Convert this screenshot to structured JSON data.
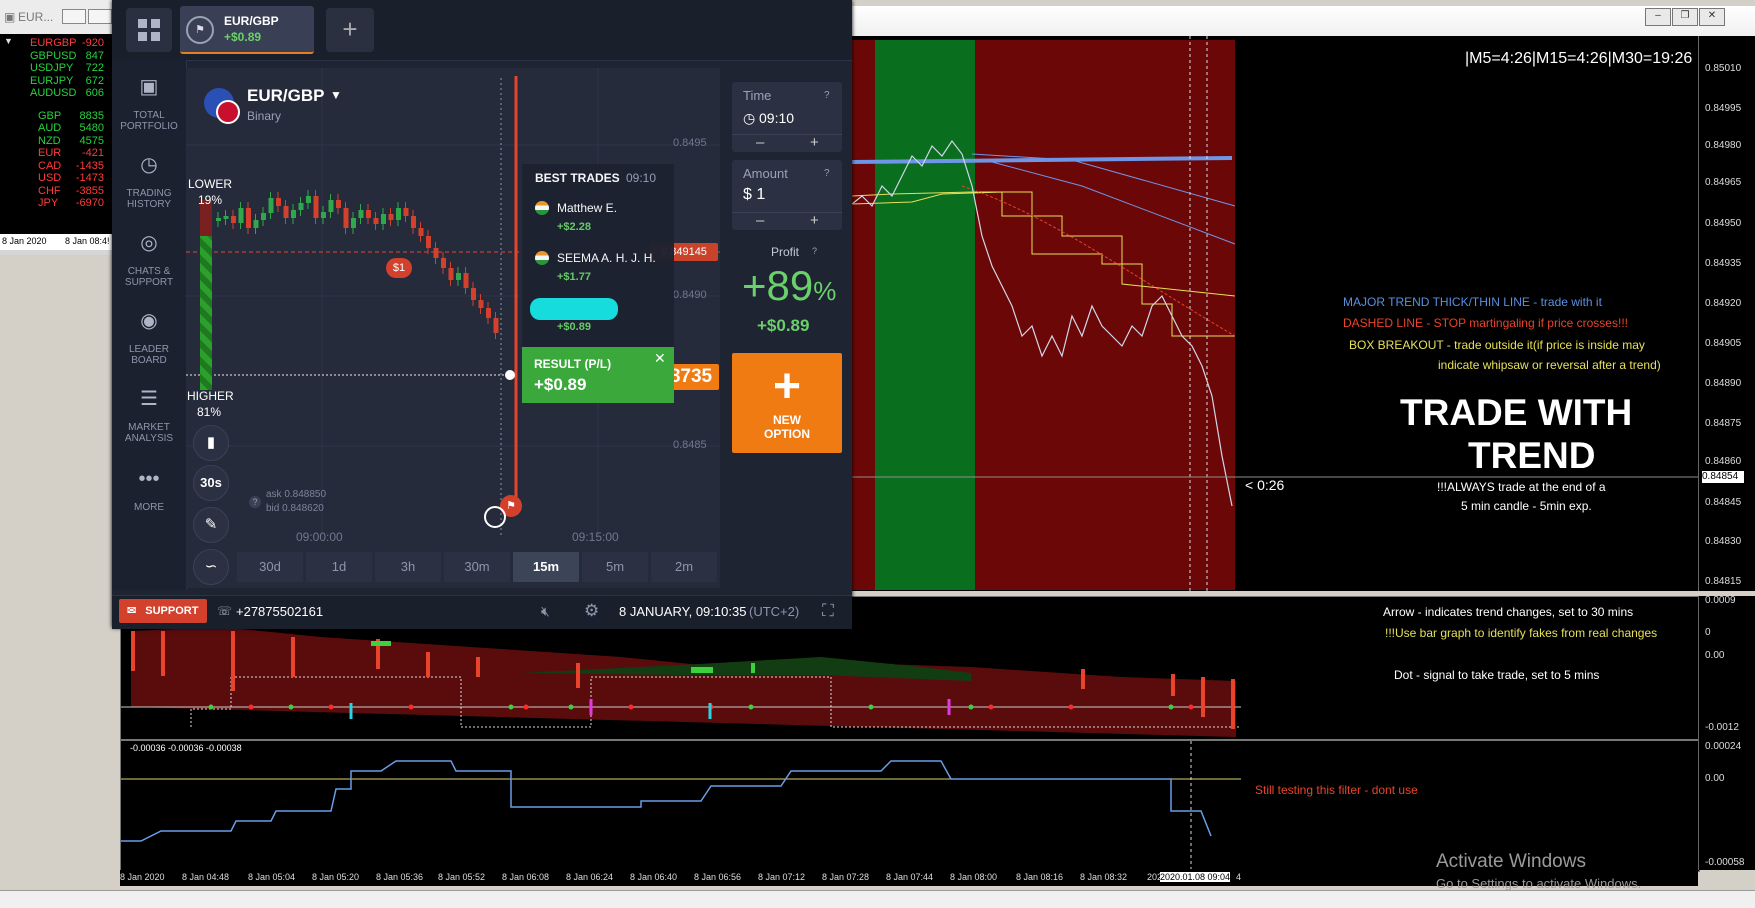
{
  "mt4": {
    "left_title": "EUR...",
    "currency_list": [
      {
        "name": "EURGBP",
        "value": "-920",
        "color": "#ff3b3b"
      },
      {
        "name": "GBPUSD",
        "value": "847",
        "color": "#27d13f"
      },
      {
        "name": "USDJPY",
        "value": "722",
        "color": "#27d13f"
      },
      {
        "name": "EURJPY",
        "value": "672",
        "color": "#27d13f"
      },
      {
        "name": "AUDUSD",
        "value": "606",
        "color": "#27d13f"
      },
      {
        "name": "GBP",
        "value": "8835",
        "color": "#27d13f"
      },
      {
        "name": "AUD",
        "value": "5480",
        "color": "#27d13f"
      },
      {
        "name": "NZD",
        "value": "4575",
        "color": "#27d13f"
      },
      {
        "name": "EUR",
        "value": "-421",
        "color": "#ff3b3b"
      },
      {
        "name": "CAD",
        "value": "-1435",
        "color": "#ff3b3b"
      },
      {
        "name": "USD",
        "value": "-1473",
        "color": "#ff3b3b"
      },
      {
        "name": "CHF",
        "value": "-3855",
        "color": "#ff3b3b"
      },
      {
        "name": "JPY",
        "value": "-6970",
        "color": "#ff3b3b"
      }
    ],
    "left_dates": [
      "8 Jan 2020",
      "8 Jan 08:4!"
    ],
    "timer_text": "|M5=4:26|M15=4:26|M30=19:26",
    "candle_timer": "< 0:26",
    "price_axis": [
      "0.85010",
      "0.84995",
      "0.84980",
      "0.84965",
      "0.84950",
      "0.84935",
      "0.84920",
      "0.84905",
      "0.84890",
      "0.84875",
      "0.84860",
      "0.84854",
      "0.84845",
      "0.84830",
      "0.84815"
    ],
    "sub1_axis": [
      "0.0009",
      "0",
      "0.00",
      "-0.0012"
    ],
    "sub2_axis": [
      "0.00024",
      "0.00",
      "-0.00058"
    ],
    "sub2_header": "-0.00036 -0.00036 -0.00038",
    "annotations": {
      "major_trend": "MAJOR TREND THICK/THIN LINE  - trade with it",
      "dashed_line": "DASHED LINE - STOP martingaling if price crosses!!!",
      "box_breakout": "BOX BREAKOUT - trade outside it(if price is inside may",
      "box_breakout2": "indicate whipsaw or reversal after a trend)",
      "trade_with": "TRADE WITH",
      "trend": "TREND",
      "always1": "!!!ALWAYS trade at the end of a",
      "always2": "5 min candle - 5min exp.",
      "arrow": "Arrow - indicates trend changes, set to 30 mins",
      "use_bar": "!!!Use bar graph to identify fakes from real changes",
      "dot": "Dot - signal to take trade, set to 5 mins",
      "still_testing": "Still testing this filter - dont use"
    },
    "timeline": [
      "8 Jan 2020",
      "8 Jan 04:48",
      "8 Jan 05:04",
      "8 Jan 05:20",
      "8 Jan 05:36",
      "8 Jan 05:52",
      "8 Jan 06:08",
      "8 Jan 06:24",
      "8 Jan 06:40",
      "8 Jan 06:56",
      "8 Jan 07:12",
      "8 Jan 07:28",
      "8 Jan 07:44",
      "8 Jan 08:00",
      "8 Jan 08:16",
      "8 Jan 08:32",
      "202",
      "2020.01.08 09:04",
      "4"
    ],
    "watermark1": "Activate Windows",
    "watermark2": "Go to Settings to activate Windows."
  },
  "iq": {
    "tab": {
      "pair": "EUR/GBP",
      "profit": "+$0.89"
    },
    "asset": {
      "name": "EUR/GBP",
      "type": "Binary"
    },
    "sidebar": [
      {
        "label1": "TOTAL",
        "label2": "PORTFOLIO",
        "icon": "briefcase-icon"
      },
      {
        "label1": "TRADING",
        "label2": "HISTORY",
        "icon": "history-icon"
      },
      {
        "label1": "CHATS &",
        "label2": "SUPPORT",
        "icon": "chat-icon"
      },
      {
        "label1": "LEADER",
        "label2": "BOARD",
        "icon": "leaderboard-icon"
      },
      {
        "label1": "MARKET",
        "label2": "ANALYSIS",
        "icon": "analysis-icon"
      },
      {
        "label1": "MORE",
        "label2": "",
        "icon": "more-icon"
      }
    ],
    "lower": {
      "label": "LOWER",
      "pct": "19%"
    },
    "higher": {
      "label": "HIGHER",
      "pct": "81%"
    },
    "chart_prices": [
      "0.8495",
      "0.8490",
      "0.8485"
    ],
    "current_price_tag": "0.849145",
    "price_tag_right": "8735",
    "ask": "ask 0.848850",
    "bid": "bid 0.848620",
    "time_labels": [
      "09:00:00",
      "09:15:00"
    ],
    "bet_marker": "$1",
    "expiry_label": "30s",
    "best_trades": {
      "title": "BEST TRADES",
      "time": "09:10",
      "items": [
        {
          "name": "Matthew E.",
          "amount": "+$2.28"
        },
        {
          "name": "SEEMA A. H. J. H.",
          "amount": "+$1.77"
        },
        {
          "name": "",
          "amount": "+$0.89"
        }
      ]
    },
    "result": {
      "label": "RESULT (P/L)",
      "value": "+$0.89"
    },
    "time_box": {
      "label": "Time",
      "value": "09:10"
    },
    "amount_box": {
      "label": "Amount",
      "value": "$ 1"
    },
    "profit": {
      "label": "Profit",
      "pct": "+89",
      "pct_sign": "%",
      "value": "+$0.89"
    },
    "new_option": {
      "line1": "NEW",
      "line2": "OPTION"
    },
    "timeframes": [
      "30d",
      "1d",
      "3h",
      "30m",
      "15m",
      "5m",
      "2m"
    ],
    "timeframe_active": "15m",
    "support": "SUPPORT",
    "phone": "+27875502161",
    "datetime": "8 JANUARY, 09:10:35",
    "timezone": "(UTC+2)",
    "colors": {
      "accent": "#f07b12",
      "green": "#3aa83a",
      "profit_green": "#6ad06a",
      "support_red": "#d3402c"
    }
  }
}
